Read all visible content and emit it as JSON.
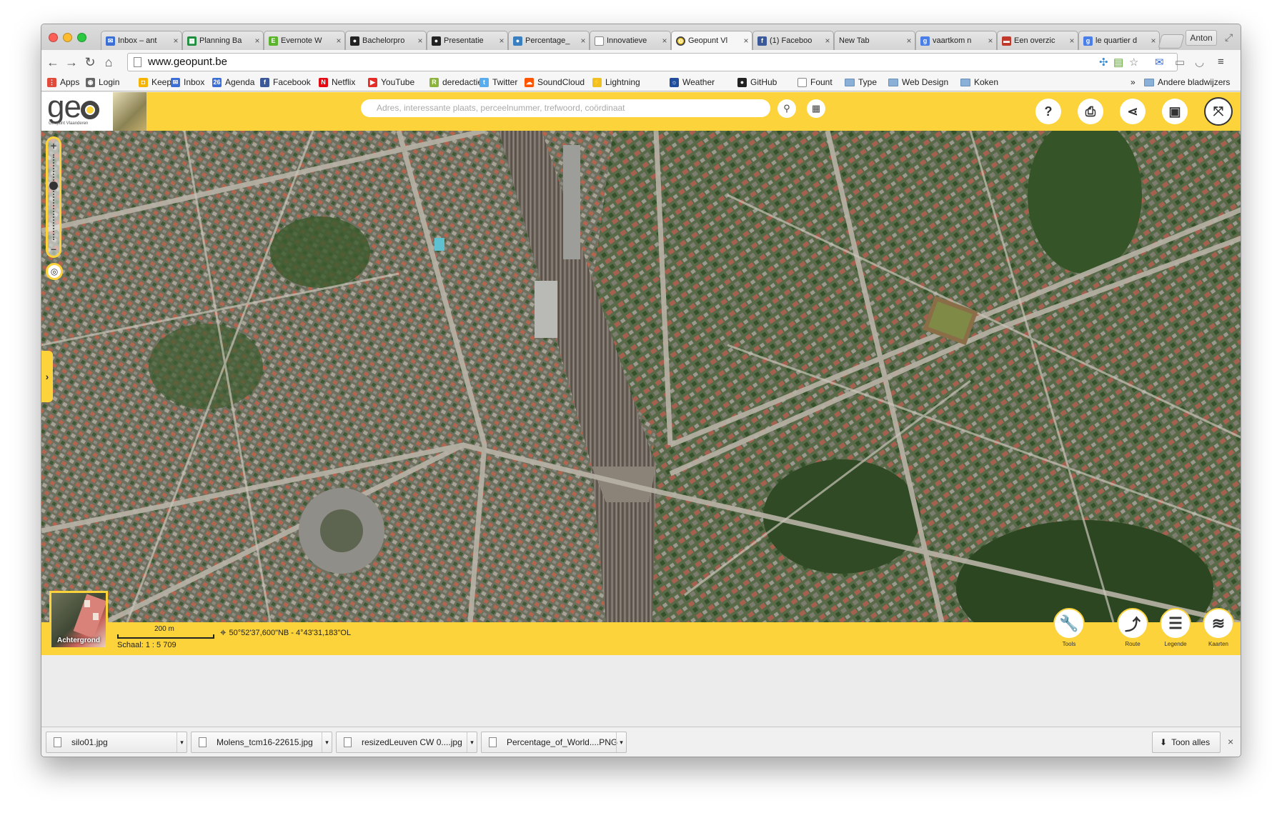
{
  "browser": {
    "tabs": [
      {
        "title": "Inbox – ant",
        "color": "#3b6fd6",
        "glyph": "✉"
      },
      {
        "title": "Planning Ba",
        "color": "#1e8e3e",
        "glyph": "▦"
      },
      {
        "title": "Evernote W",
        "color": "#5bb52a",
        "glyph": "E"
      },
      {
        "title": "Bachelorpro",
        "color": "#222222",
        "glyph": "●"
      },
      {
        "title": "Presentatie",
        "color": "#222222",
        "glyph": "●"
      },
      {
        "title": "Percentage_",
        "color": "#3a7fbf",
        "glyph": "●"
      },
      {
        "title": "Innovatieve",
        "color": "#ffffff",
        "glyph": ""
      },
      {
        "title": "Geopunt Vl",
        "color": "#fcd33a",
        "glyph": "o",
        "active": true
      },
      {
        "title": "(1) Faceboo",
        "color": "#3b5998",
        "glyph": "f"
      },
      {
        "title": "New Tab",
        "color": "",
        "glyph": ""
      },
      {
        "title": "vaartkom n",
        "color": "#4a7ee8",
        "glyph": "g"
      },
      {
        "title": "Een overzic",
        "color": "#c0392b",
        "glyph": "▬"
      },
      {
        "title": "le quartier d",
        "color": "#4a7ee8",
        "glyph": "g"
      }
    ],
    "profile": "Anton",
    "url": "www.geopunt.be",
    "bookmarks": [
      {
        "label": "Apps",
        "color": "#e24a3b",
        "glyph": "⋮",
        "type": "icon"
      },
      {
        "label": "Login",
        "color": "#666666",
        "glyph": "◉",
        "type": "icon"
      },
      {
        "label": "Keep",
        "color": "#f4b400",
        "glyph": "◘",
        "type": "icon"
      },
      {
        "label": "Inbox",
        "color": "#3b6fd6",
        "glyph": "✉",
        "type": "icon"
      },
      {
        "label": "Agenda",
        "color": "#3b6fd6",
        "glyph": "26",
        "type": "icon"
      },
      {
        "label": "Facebook",
        "color": "#3b5998",
        "glyph": "f",
        "type": "icon"
      },
      {
        "label": "Netflix",
        "color": "#e50914",
        "glyph": "N",
        "type": "icon"
      },
      {
        "label": "YouTube",
        "color": "#e52d27",
        "glyph": "▶",
        "type": "icon"
      },
      {
        "label": "deredactie",
        "color": "#8cb43c",
        "glyph": "R",
        "type": "icon"
      },
      {
        "label": "Twitter",
        "color": "#55acee",
        "glyph": "t",
        "type": "icon"
      },
      {
        "label": "SoundCloud",
        "color": "#ff5500",
        "glyph": "☁",
        "type": "icon"
      },
      {
        "label": "Lightning",
        "color": "#f0c020",
        "glyph": "⚡",
        "type": "icon"
      },
      {
        "label": "Weather",
        "color": "#1f4e9c",
        "glyph": "☼",
        "type": "icon"
      },
      {
        "label": "GitHub",
        "color": "#222222",
        "glyph": "●",
        "type": "icon"
      },
      {
        "label": "Fount",
        "color": "#ffffff",
        "glyph": "",
        "type": "page"
      },
      {
        "label": "Type",
        "type": "folder"
      },
      {
        "label": "Web Design",
        "type": "folder"
      },
      {
        "label": "Koken",
        "type": "folder"
      }
    ],
    "bookmarks_overflow": "»",
    "other_bookmarks": "Andere bladwijzers"
  },
  "app": {
    "logo_text": "ge",
    "logo_sub": "Geopunt Vlaanderen",
    "search_placeholder": "Adres, interessante plaats, perceelnummer, trefwoord, coördinaat",
    "background_label": "Achtergrond",
    "scale_bar_label": "200 m",
    "coordinates": "50°52'37,600\"NB - 4°43'31,183\"OL",
    "scale_text": "Schaal: 1 : 5 709",
    "tools": [
      {
        "label": "Tools",
        "glyph": "🔧"
      },
      {
        "label": "Route",
        "glyph": "⤴"
      },
      {
        "label": "Legende",
        "glyph": "☰"
      },
      {
        "label": "Kaarten",
        "glyph": "≋"
      }
    ]
  },
  "downloads": {
    "items": [
      "silo01.jpg",
      "Molens_tcm16-22615.jpg",
      "resizedLeuven CW   0....jpg",
      "Percentage_of_World....PNG"
    ],
    "show_all": "Toon alles",
    "close": "×"
  }
}
